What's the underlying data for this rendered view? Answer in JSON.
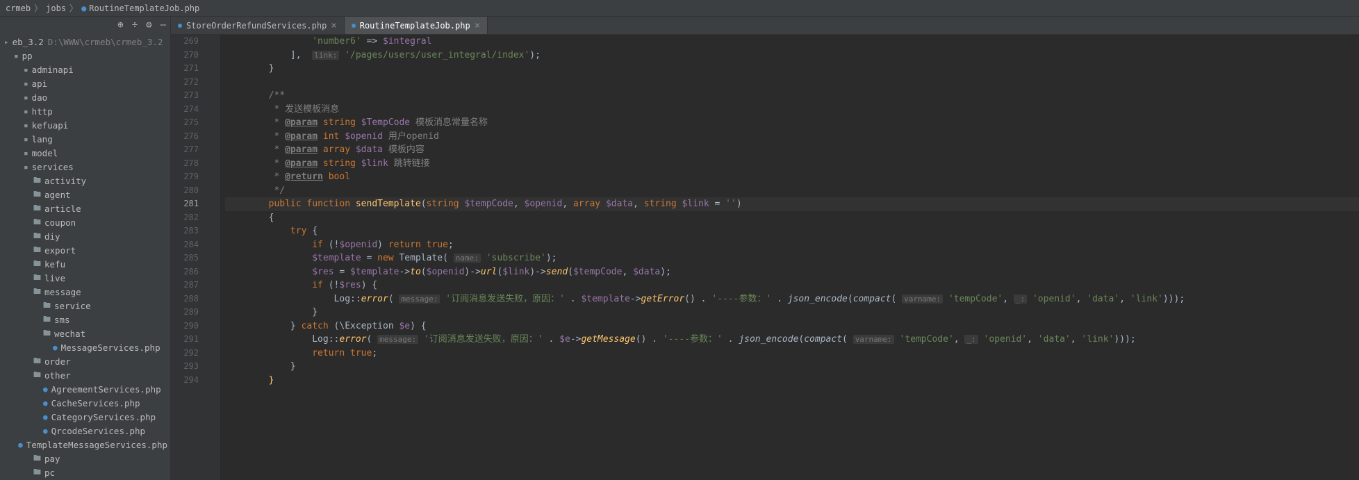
{
  "breadcrumb": {
    "parts": [
      "crmeb",
      "jobs"
    ],
    "file": "RoutineTemplateJob.php"
  },
  "sidebar": {
    "tools": [
      "target",
      "divide",
      "gear",
      "hide"
    ],
    "tree": [
      {
        "indent": 0,
        "icon": "root",
        "label": "eb_3.2",
        "suffix": "D:\\WWW\\crmeb\\crmeb_3.2"
      },
      {
        "indent": 1,
        "icon": "mod",
        "label": "pp"
      },
      {
        "indent": 2,
        "icon": "mod",
        "label": "adminapi"
      },
      {
        "indent": 2,
        "icon": "mod",
        "label": "api"
      },
      {
        "indent": 2,
        "icon": "mod",
        "label": "dao"
      },
      {
        "indent": 2,
        "icon": "mod",
        "label": "http"
      },
      {
        "indent": 2,
        "icon": "mod",
        "label": "kefuapi"
      },
      {
        "indent": 2,
        "icon": "mod",
        "label": "lang"
      },
      {
        "indent": 2,
        "icon": "mod",
        "label": "model"
      },
      {
        "indent": 2,
        "icon": "mod",
        "label": "services"
      },
      {
        "indent": 3,
        "icon": "folder",
        "label": "activity"
      },
      {
        "indent": 3,
        "icon": "folder",
        "label": "agent"
      },
      {
        "indent": 3,
        "icon": "folder",
        "label": "article"
      },
      {
        "indent": 3,
        "icon": "folder",
        "label": "coupon"
      },
      {
        "indent": 3,
        "icon": "folder",
        "label": "diy"
      },
      {
        "indent": 3,
        "icon": "folder",
        "label": "export"
      },
      {
        "indent": 3,
        "icon": "folder",
        "label": "kefu"
      },
      {
        "indent": 3,
        "icon": "folder",
        "label": "live"
      },
      {
        "indent": 3,
        "icon": "folder",
        "label": "message"
      },
      {
        "indent": 4,
        "icon": "folder",
        "label": "service"
      },
      {
        "indent": 4,
        "icon": "folder",
        "label": "sms"
      },
      {
        "indent": 4,
        "icon": "folder-open",
        "label": "wechat"
      },
      {
        "indent": 5,
        "icon": "php",
        "label": "MessageServices.php"
      },
      {
        "indent": 3,
        "icon": "folder",
        "label": "order"
      },
      {
        "indent": 3,
        "icon": "folder-open",
        "label": "other"
      },
      {
        "indent": 4,
        "icon": "php",
        "label": "AgreementServices.php"
      },
      {
        "indent": 4,
        "icon": "php",
        "label": "CacheServices.php"
      },
      {
        "indent": 4,
        "icon": "php",
        "label": "CategoryServices.php"
      },
      {
        "indent": 4,
        "icon": "php",
        "label": "QrcodeServices.php"
      },
      {
        "indent": 4,
        "icon": "php",
        "label": "TemplateMessageServices.php"
      },
      {
        "indent": 3,
        "icon": "folder",
        "label": "pay"
      },
      {
        "indent": 3,
        "icon": "folder",
        "label": "pc"
      }
    ]
  },
  "tabs": [
    {
      "label": "StoreOrderRefundServices.php",
      "active": false
    },
    {
      "label": "RoutineTemplateJob.php",
      "active": true
    }
  ],
  "code": {
    "start": 269,
    "current": 281,
    "lines": [
      {
        "n": 269,
        "seg": [
          {
            "t": "                ",
            "c": ""
          },
          {
            "t": "'number6'",
            "c": "str"
          },
          {
            "t": " => ",
            "c": ""
          },
          {
            "t": "$integral",
            "c": "var"
          }
        ]
      },
      {
        "n": 270,
        "seg": [
          {
            "t": "            ],  ",
            "c": ""
          },
          {
            "t": "link:",
            "c": "param-hint"
          },
          {
            "t": " ",
            "c": ""
          },
          {
            "t": "'/pages/users/user_integral/index'",
            "c": "str"
          },
          {
            "t": ");",
            "c": ""
          }
        ]
      },
      {
        "n": 271,
        "seg": [
          {
            "t": "        }",
            "c": ""
          }
        ]
      },
      {
        "n": 272,
        "seg": [
          {
            "t": "",
            "c": ""
          }
        ]
      },
      {
        "n": 273,
        "seg": [
          {
            "t": "        ",
            "c": ""
          },
          {
            "t": "/**",
            "c": "comment"
          }
        ]
      },
      {
        "n": 274,
        "seg": [
          {
            "t": "         * 发送模板消息",
            "c": "comment"
          }
        ]
      },
      {
        "n": 275,
        "seg": [
          {
            "t": "         * ",
            "c": "comment"
          },
          {
            "t": "@param",
            "c": "doc-tag"
          },
          {
            "t": " ",
            "c": "comment"
          },
          {
            "t": "string",
            "c": "kw"
          },
          {
            "t": " ",
            "c": ""
          },
          {
            "t": "$TempCode",
            "c": "var"
          },
          {
            "t": " 模板消息常量名称",
            "c": "comment"
          }
        ]
      },
      {
        "n": 276,
        "seg": [
          {
            "t": "         * ",
            "c": "comment"
          },
          {
            "t": "@param",
            "c": "doc-tag"
          },
          {
            "t": " ",
            "c": "comment"
          },
          {
            "t": "int",
            "c": "kw"
          },
          {
            "t": " ",
            "c": ""
          },
          {
            "t": "$openid",
            "c": "var"
          },
          {
            "t": " 用户openid",
            "c": "comment"
          }
        ]
      },
      {
        "n": 277,
        "seg": [
          {
            "t": "         * ",
            "c": "comment"
          },
          {
            "t": "@param",
            "c": "doc-tag"
          },
          {
            "t": " ",
            "c": "comment"
          },
          {
            "t": "array",
            "c": "kw"
          },
          {
            "t": " ",
            "c": ""
          },
          {
            "t": "$data",
            "c": "var"
          },
          {
            "t": " 模板内容",
            "c": "comment"
          }
        ]
      },
      {
        "n": 278,
        "seg": [
          {
            "t": "         * ",
            "c": "comment"
          },
          {
            "t": "@param",
            "c": "doc-tag"
          },
          {
            "t": " ",
            "c": "comment"
          },
          {
            "t": "string",
            "c": "kw"
          },
          {
            "t": " ",
            "c": ""
          },
          {
            "t": "$link",
            "c": "var"
          },
          {
            "t": " 跳转链接",
            "c": "comment"
          }
        ]
      },
      {
        "n": 279,
        "seg": [
          {
            "t": "         * ",
            "c": "comment"
          },
          {
            "t": "@return",
            "c": "doc-tag"
          },
          {
            "t": " ",
            "c": "comment"
          },
          {
            "t": "bool",
            "c": "kw"
          }
        ]
      },
      {
        "n": 280,
        "seg": [
          {
            "t": "         */",
            "c": "comment"
          }
        ]
      },
      {
        "n": 281,
        "hl": true,
        "seg": [
          {
            "t": "        ",
            "c": ""
          },
          {
            "t": "public function ",
            "c": "kw"
          },
          {
            "t": "sendTemplate",
            "c": "fn-name"
          },
          {
            "t": "(",
            "c": ""
          },
          {
            "t": "string ",
            "c": "type"
          },
          {
            "t": "$tempCode",
            "c": "var"
          },
          {
            "t": ", ",
            "c": ""
          },
          {
            "t": "$openid",
            "c": "var"
          },
          {
            "t": ", ",
            "c": ""
          },
          {
            "t": "array ",
            "c": "type"
          },
          {
            "t": "$data",
            "c": "var"
          },
          {
            "t": ", ",
            "c": ""
          },
          {
            "t": "string ",
            "c": "type"
          },
          {
            "t": "$link",
            "c": "var"
          },
          {
            "t": " = ",
            "c": ""
          },
          {
            "t": "''",
            "c": "str"
          },
          {
            "t": ")",
            "c": ""
          }
        ]
      },
      {
        "n": 282,
        "seg": [
          {
            "t": "        {",
            "c": ""
          }
        ]
      },
      {
        "n": 283,
        "seg": [
          {
            "t": "            ",
            "c": ""
          },
          {
            "t": "try ",
            "c": "kw"
          },
          {
            "t": "{",
            "c": ""
          }
        ]
      },
      {
        "n": 284,
        "seg": [
          {
            "t": "                ",
            "c": ""
          },
          {
            "t": "if ",
            "c": "kw"
          },
          {
            "t": "(!",
            "c": ""
          },
          {
            "t": "$openid",
            "c": "var"
          },
          {
            "t": ") ",
            "c": ""
          },
          {
            "t": "return true",
            "c": "kw"
          },
          {
            "t": ";",
            "c": ""
          }
        ]
      },
      {
        "n": 285,
        "seg": [
          {
            "t": "                ",
            "c": ""
          },
          {
            "t": "$template",
            "c": "var"
          },
          {
            "t": " = ",
            "c": ""
          },
          {
            "t": "new ",
            "c": "kw"
          },
          {
            "t": "Template",
            "c": "class-name"
          },
          {
            "t": "( ",
            "c": ""
          },
          {
            "t": "name:",
            "c": "param-hint"
          },
          {
            "t": " ",
            "c": ""
          },
          {
            "t": "'subscribe'",
            "c": "str"
          },
          {
            "t": ");",
            "c": ""
          }
        ]
      },
      {
        "n": 286,
        "seg": [
          {
            "t": "                ",
            "c": ""
          },
          {
            "t": "$res",
            "c": "var"
          },
          {
            "t": " = ",
            "c": ""
          },
          {
            "t": "$template",
            "c": "var"
          },
          {
            "t": "->",
            "c": "op"
          },
          {
            "t": "to",
            "c": "method"
          },
          {
            "t": "(",
            "c": ""
          },
          {
            "t": "$openid",
            "c": "var"
          },
          {
            "t": ")->",
            "c": "op"
          },
          {
            "t": "url",
            "c": "method"
          },
          {
            "t": "(",
            "c": ""
          },
          {
            "t": "$link",
            "c": "var"
          },
          {
            "t": ")->",
            "c": "op"
          },
          {
            "t": "send",
            "c": "method"
          },
          {
            "t": "(",
            "c": ""
          },
          {
            "t": "$tempCode",
            "c": "var"
          },
          {
            "t": ", ",
            "c": ""
          },
          {
            "t": "$data",
            "c": "var"
          },
          {
            "t": ");",
            "c": ""
          }
        ]
      },
      {
        "n": 287,
        "seg": [
          {
            "t": "                ",
            "c": ""
          },
          {
            "t": "if ",
            "c": "kw"
          },
          {
            "t": "(!",
            "c": ""
          },
          {
            "t": "$res",
            "c": "var"
          },
          {
            "t": ") {",
            "c": ""
          }
        ]
      },
      {
        "n": 288,
        "seg": [
          {
            "t": "                    ",
            "c": ""
          },
          {
            "t": "Log",
            "c": "class-name"
          },
          {
            "t": "::",
            "c": "op"
          },
          {
            "t": "error",
            "c": "method"
          },
          {
            "t": "( ",
            "c": ""
          },
          {
            "t": "message:",
            "c": "param-hint"
          },
          {
            "t": " ",
            "c": ""
          },
          {
            "t": "'订阅消息发送失败，原因：'",
            "c": "str"
          },
          {
            "t": " . ",
            "c": ""
          },
          {
            "t": "$template",
            "c": "var"
          },
          {
            "t": "->",
            "c": "op"
          },
          {
            "t": "getError",
            "c": "method"
          },
          {
            "t": "() . ",
            "c": ""
          },
          {
            "t": "'----参数：'",
            "c": "str"
          },
          {
            "t": " . ",
            "c": ""
          },
          {
            "t": "json_encode",
            "c": "fn-call"
          },
          {
            "t": "(",
            "c": ""
          },
          {
            "t": "compact",
            "c": "fn-call"
          },
          {
            "t": "( ",
            "c": ""
          },
          {
            "t": "varname:",
            "c": "param-hint"
          },
          {
            "t": " ",
            "c": ""
          },
          {
            "t": "'tempCode'",
            "c": "str"
          },
          {
            "t": ", ",
            "c": ""
          },
          {
            "t": "_:",
            "c": "param-hint"
          },
          {
            "t": " ",
            "c": ""
          },
          {
            "t": "'openid'",
            "c": "str"
          },
          {
            "t": ", ",
            "c": ""
          },
          {
            "t": "'data'",
            "c": "str"
          },
          {
            "t": ", ",
            "c": ""
          },
          {
            "t": "'link'",
            "c": "str"
          },
          {
            "t": ")));",
            "c": ""
          }
        ]
      },
      {
        "n": 289,
        "seg": [
          {
            "t": "                }",
            "c": ""
          }
        ]
      },
      {
        "n": 290,
        "seg": [
          {
            "t": "            } ",
            "c": ""
          },
          {
            "t": "catch ",
            "c": "kw"
          },
          {
            "t": "(\\Exception ",
            "c": ""
          },
          {
            "t": "$e",
            "c": "var"
          },
          {
            "t": ") {",
            "c": ""
          }
        ]
      },
      {
        "n": 291,
        "seg": [
          {
            "t": "                ",
            "c": ""
          },
          {
            "t": "Log",
            "c": "class-name"
          },
          {
            "t": "::",
            "c": "op"
          },
          {
            "t": "error",
            "c": "method"
          },
          {
            "t": "( ",
            "c": ""
          },
          {
            "t": "message:",
            "c": "param-hint"
          },
          {
            "t": " ",
            "c": ""
          },
          {
            "t": "'订阅消息发送失败，原因：'",
            "c": "str"
          },
          {
            "t": " . ",
            "c": ""
          },
          {
            "t": "$e",
            "c": "var"
          },
          {
            "t": "->",
            "c": "op"
          },
          {
            "t": "getMessage",
            "c": "method"
          },
          {
            "t": "() . ",
            "c": ""
          },
          {
            "t": "'----参数：'",
            "c": "str"
          },
          {
            "t": " . ",
            "c": ""
          },
          {
            "t": "json_encode",
            "c": "fn-call"
          },
          {
            "t": "(",
            "c": ""
          },
          {
            "t": "compact",
            "c": "fn-call"
          },
          {
            "t": "( ",
            "c": ""
          },
          {
            "t": "varname:",
            "c": "param-hint"
          },
          {
            "t": " ",
            "c": ""
          },
          {
            "t": "'tempCode'",
            "c": "str"
          },
          {
            "t": ", ",
            "c": ""
          },
          {
            "t": "_:",
            "c": "param-hint"
          },
          {
            "t": " ",
            "c": ""
          },
          {
            "t": "'openid'",
            "c": "str"
          },
          {
            "t": ", ",
            "c": ""
          },
          {
            "t": "'data'",
            "c": "str"
          },
          {
            "t": ", ",
            "c": ""
          },
          {
            "t": "'link'",
            "c": "str"
          },
          {
            "t": ")));",
            "c": ""
          }
        ]
      },
      {
        "n": 292,
        "seg": [
          {
            "t": "                ",
            "c": ""
          },
          {
            "t": "return true",
            "c": "kw"
          },
          {
            "t": ";",
            "c": ""
          }
        ]
      },
      {
        "n": 293,
        "seg": [
          {
            "t": "            }",
            "c": ""
          }
        ]
      },
      {
        "n": 294,
        "seg": [
          {
            "t": "        ",
            "c": ""
          },
          {
            "t": "}",
            "c": "fn-name"
          }
        ]
      }
    ]
  }
}
